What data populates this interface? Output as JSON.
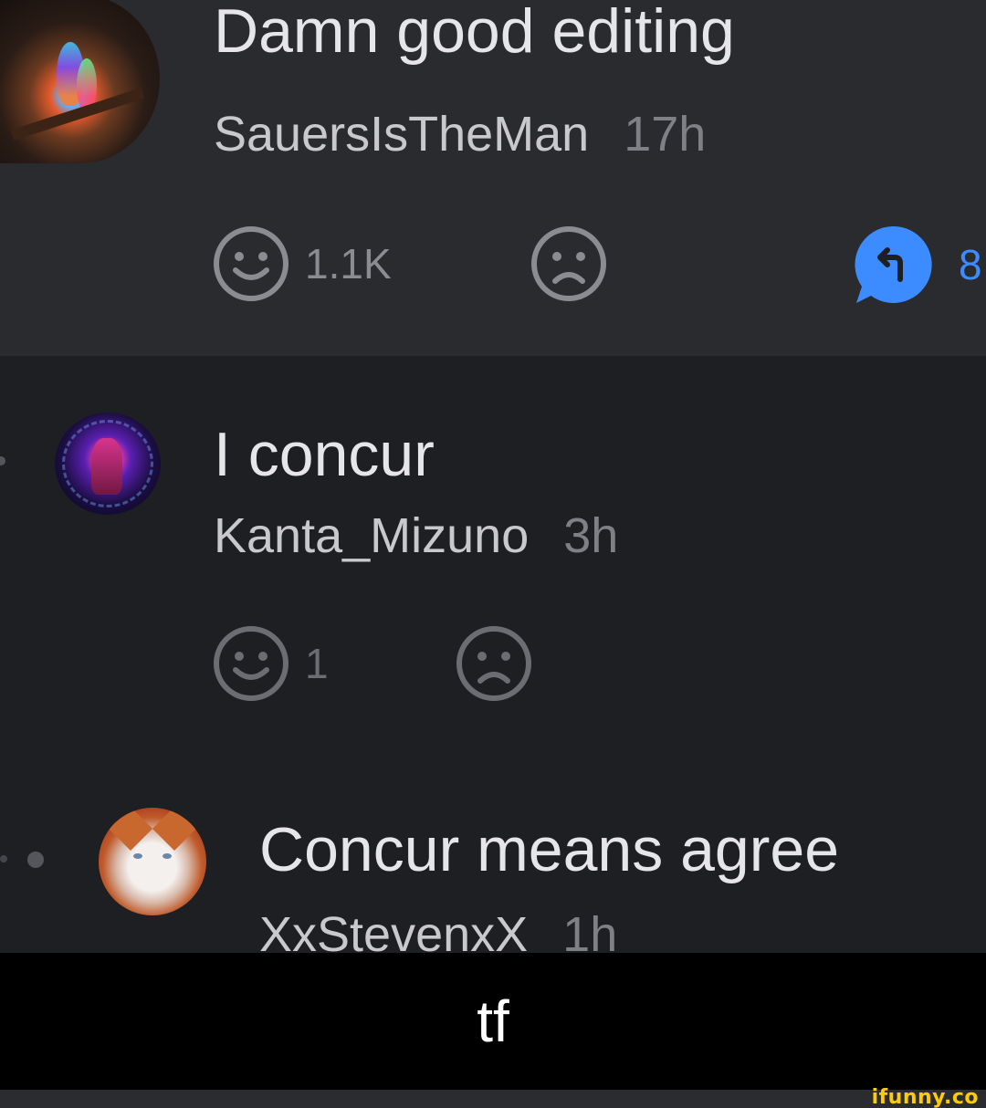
{
  "comments": [
    {
      "text": "Damn good editing",
      "username": "SauersIsTheMan",
      "time": "17h",
      "likes": "1.1K",
      "replies": "8"
    },
    {
      "text": "I concur",
      "username": "Kanta_Mizuno",
      "time": "3h",
      "likes": "1"
    },
    {
      "text": "Concur means agree",
      "username": "XxStevenxX",
      "time": "1h"
    }
  ],
  "caption": "tf",
  "watermark": "ifunny.co",
  "colors": {
    "background": "#1e1f23",
    "highlight_background": "#2a2b2f",
    "reply_accent": "#3d8cff",
    "watermark": "#ffcc00"
  },
  "icons": [
    "smile-icon",
    "frown-icon",
    "reply-bubble-icon"
  ]
}
